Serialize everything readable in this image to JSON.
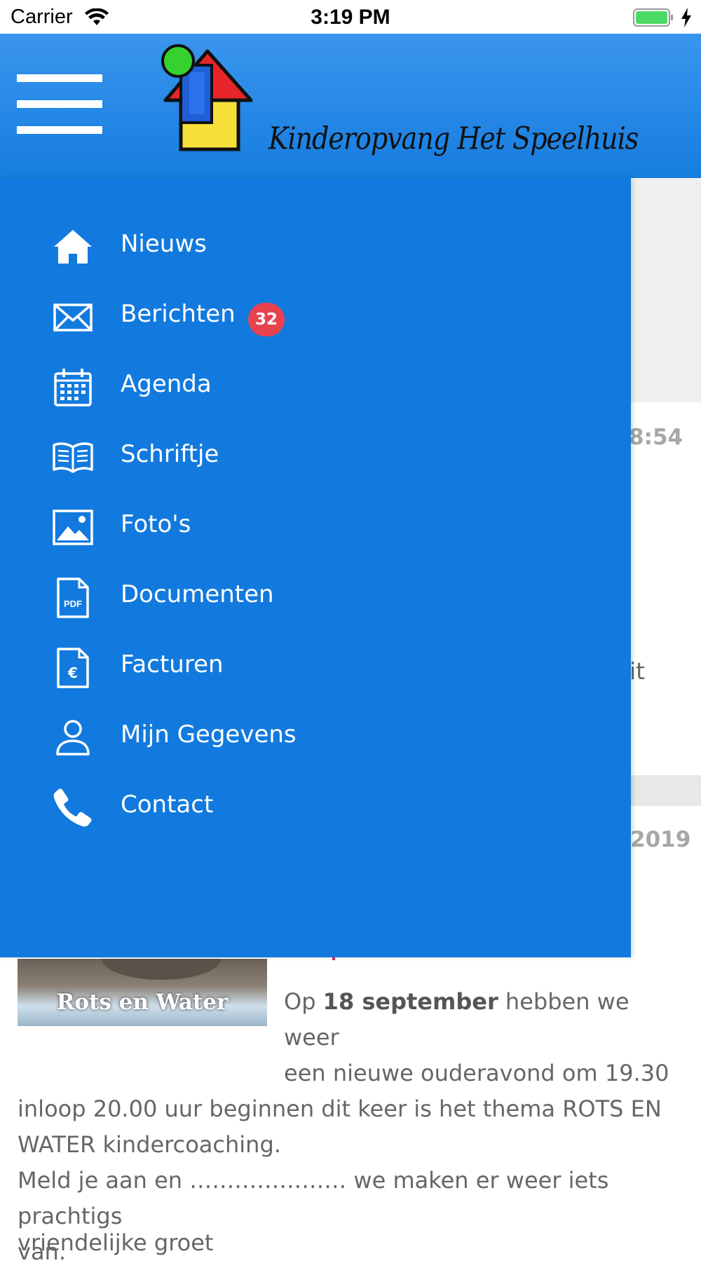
{
  "status_bar": {
    "carrier": "Carrier",
    "time": "3:19 PM",
    "battery_color": "#4cd964"
  },
  "header": {
    "logo_text": "Kinderopvang Het Speelhuis",
    "menu_icon": "hamburger-icon",
    "colors": {
      "top": "#3a95ee",
      "bottom": "#167ddf"
    }
  },
  "drawer": {
    "background": "#127ade",
    "items": [
      {
        "label": "Nieuws",
        "icon": "home-icon"
      },
      {
        "label": "Berichten",
        "icon": "envelope-icon",
        "badge": "32"
      },
      {
        "label": "Agenda",
        "icon": "calendar-icon"
      },
      {
        "label": "Schriftje",
        "icon": "book-icon"
      },
      {
        "label": "Foto's",
        "icon": "image-icon"
      },
      {
        "label": "Documenten",
        "icon": "pdf-icon"
      },
      {
        "label": "Facturen",
        "icon": "invoice-euro-icon"
      },
      {
        "label": "Mijn Gegevens",
        "icon": "user-icon"
      },
      {
        "label": "Contact",
        "icon": "phone-icon"
      }
    ]
  },
  "background_content": {
    "time_fragment": "8:54",
    "text_fragment": "it",
    "date_fragment": "2019",
    "image_caption": "Rots en Water",
    "news_body": {
      "prefix": "Op ",
      "bold_date": "18 september",
      "line1_rest": " hebben we weer",
      "line2": "een nieuwe ouderavond om 19.30",
      "line3": "inloop 20.00 uur beginnen dit keer is het thema ROTS EN",
      "line4": "WATER kindercoaching.",
      "line5": "Meld je aan en ………………… we maken er weer iets prachtigs",
      "line6": "van."
    },
    "bottom_fragment": "vriendelijke groet"
  }
}
